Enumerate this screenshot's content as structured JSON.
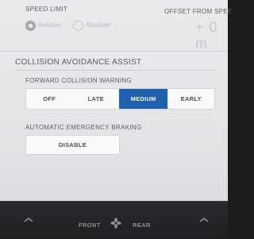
{
  "speed_limit": {
    "label": "SPEED LIMIT",
    "options": [
      "Relative",
      "Absolute"
    ],
    "selected": "Relative"
  },
  "offset": {
    "label": "OFFSET FROM SPEE",
    "value": "+ 0 m"
  },
  "collision": {
    "section_title": "COLLISION AVOIDANCE ASSIST",
    "forward_warning": {
      "label": "FORWARD COLLISION WARNING",
      "options": [
        "OFF",
        "LATE",
        "MEDIUM",
        "EARLY"
      ],
      "selected": "MEDIUM"
    },
    "aeb": {
      "label": "AUTOMATIC EMERGENCY BRAKING",
      "button": "DISABLE"
    }
  },
  "bottom_bar": {
    "front": "FRONT",
    "rear": "REAR"
  },
  "colors": {
    "accent": "#1f5fae",
    "screen_bg": "#e6e7e9",
    "bar_bg": "#1f2022"
  }
}
